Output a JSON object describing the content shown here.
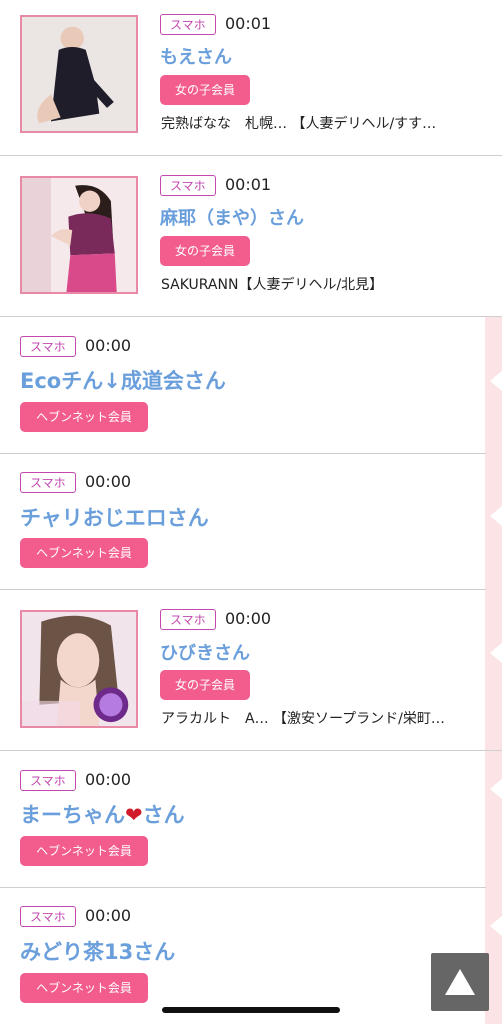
{
  "entries": [
    {
      "device": "スマホ",
      "time": "00:01",
      "name": "もえさん",
      "member": "女の子会員",
      "shop": "完熟ばなな　札幌… 【人妻デリヘル/すす…"
    },
    {
      "device": "スマホ",
      "time": "00:01",
      "name": "麻耶（まや）さん",
      "member": "女の子会員",
      "shop": "SAKURANN【人妻デリヘル/北見】"
    },
    {
      "device": "スマホ",
      "time": "00:00",
      "name": "Ecoチん↓成道会さん",
      "member": "ヘブンネット会員"
    },
    {
      "device": "スマホ",
      "time": "00:00",
      "name": "チャリおじエロさん",
      "member": "ヘブンネット会員"
    },
    {
      "device": "スマホ",
      "time": "00:00",
      "name": "ひびきさん",
      "member": "女の子会員",
      "shop": "アラカルト　A… 【激安ソープランド/栄町…"
    },
    {
      "device": "スマホ",
      "time": "00:00",
      "name_prefix": "まーちゃん",
      "name_heart": "❤",
      "name_suffix": "さん",
      "member": "ヘブンネット会員"
    },
    {
      "device": "スマホ",
      "time": "00:00",
      "name": "みどり茶13さん",
      "member": "ヘブンネット会員"
    }
  ],
  "colors": {
    "name": "#6a9fdc",
    "member_badge": "#f25d8e",
    "device_badge": "#c447b0",
    "thumb_border": "#e88aa6",
    "stripe": "#fbe3e6"
  },
  "icons": {
    "scroll_top": "triangle-up-icon"
  }
}
